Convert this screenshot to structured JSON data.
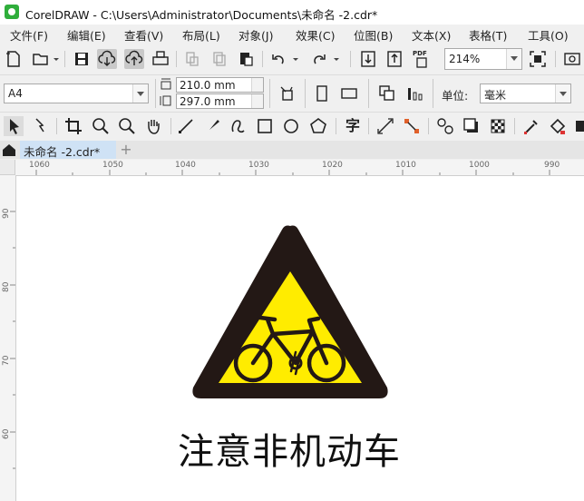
{
  "window": {
    "title": "CorelDRAW - C:\\Users\\Administrator\\Documents\\未命名 -2.cdr*"
  },
  "menu": [
    {
      "label": "文件(F)"
    },
    {
      "label": "编辑(E)"
    },
    {
      "label": "查看(V)"
    },
    {
      "label": "布局(L)"
    },
    {
      "label": "对象(J)"
    },
    {
      "label": "效果(C)"
    },
    {
      "label": "位图(B)"
    },
    {
      "label": "文本(X)"
    },
    {
      "label": "表格(T)"
    },
    {
      "label": "工具(O)"
    }
  ],
  "standard_toolbar": {
    "zoom_value": "214%",
    "pdf_label": "PDF"
  },
  "property_bar": {
    "page_size": "A4",
    "width": "210.0 mm",
    "height": "297.0 mm",
    "units_label": "单位:",
    "units_value": "毫米"
  },
  "toolbox": {
    "text_tool_glyph": "字"
  },
  "document_tabs": [
    {
      "label": "未命名 -2.cdr*"
    }
  ],
  "rulers": {
    "horizontal": [
      "1060",
      "1050",
      "1040",
      "1030",
      "1020",
      "1010",
      "1000",
      "990"
    ],
    "vertical": [
      "90",
      "80",
      "70",
      "60"
    ]
  },
  "artwork": {
    "sign_text": "注意非机动车",
    "colors": {
      "sign_yellow": "#ffec00",
      "sign_border": "#231815",
      "ink": "#111111"
    },
    "icon": "bicycle-icon"
  }
}
